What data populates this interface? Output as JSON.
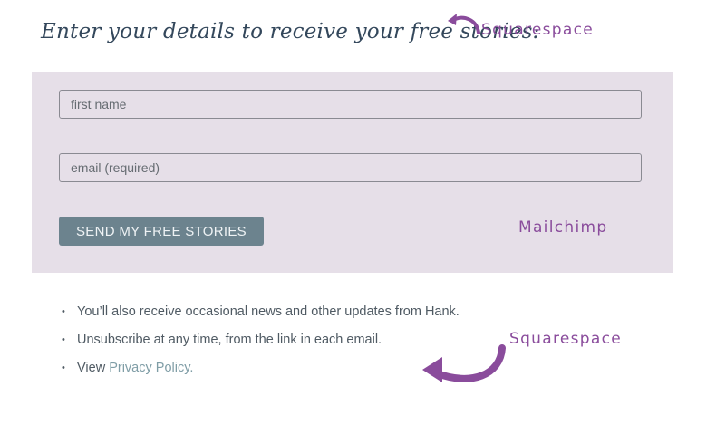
{
  "heading": "Enter your details to receive your free stories:",
  "annotations": {
    "top": "Squarespace",
    "middle": "Mailchimp",
    "bottom": "Squarespace",
    "color": "#8a4c9c"
  },
  "form": {
    "first_name_placeholder": "first name",
    "email_placeholder": "email (required)",
    "submit_label": "SEND MY FREE STORIES",
    "panel_color": "#e6dfe8",
    "button_color": "#6c838e"
  },
  "notes": {
    "item1": "You’ll also receive occasional news and other updates from Hank.",
    "item2": "Unsubscribe at any time, from the link in each email.",
    "item3_prefix": "View ",
    "item3_link": "Privacy Policy."
  },
  "icons": {
    "top_arrow": "curved-arrow-icon",
    "bottom_arrow": "curved-arrow-icon"
  }
}
